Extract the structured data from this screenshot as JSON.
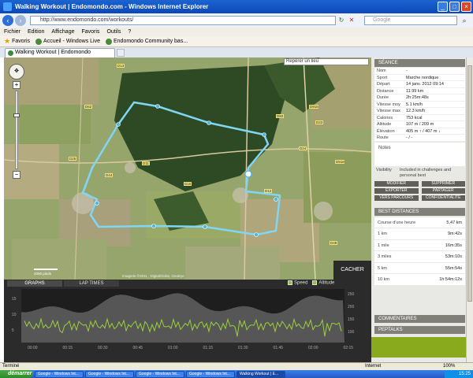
{
  "window": {
    "title": "Walking Workout | Endomondo.com - Windows Internet Explorer"
  },
  "address": {
    "url": "http://www.endomondo.com/workouts/",
    "search_placeholder": "Google"
  },
  "menu": [
    "Fichier",
    "Edition",
    "Affichage",
    "Favoris",
    "Outils",
    "?"
  ],
  "favbar": {
    "favoris": "Favoris",
    "items": [
      "Accueil - Windows Live",
      "Endomondo  Community bas..."
    ]
  },
  "tab": {
    "label": "Walking Workout | Endomondo"
  },
  "map": {
    "search_placeholder": "Repérer un lieu",
    "labels": [
      "D25",
      "D62",
      "D13",
      "D44",
      "D11",
      "D15",
      "D915",
      "D23",
      "D12",
      "D24",
      "D82",
      "D918",
      "D49"
    ],
    "copyright": "Imagerie ©2011 , DigitalGlobe, GeoEye",
    "scale": "2000 pieds"
  },
  "graph": {
    "tabs": [
      "GRAPHS",
      "LAP TIMES"
    ],
    "checks": [
      "Speed",
      "Altitude"
    ],
    "cacher": "CACHER",
    "x_ticks": [
      "00:00",
      "00:15",
      "00:30",
      "00:45",
      "01:00",
      "01:15",
      "01:30",
      "01:45",
      "02:00",
      "02:15"
    ],
    "left_ticks": [
      "15",
      "10",
      "5"
    ],
    "right_ticks": [
      "250",
      "200",
      "150",
      "100"
    ]
  },
  "session": {
    "header": "SÉANCE",
    "rows": [
      {
        "k": "Nom",
        "v": "-"
      },
      {
        "k": "Sport",
        "v": "Marche nordique"
      },
      {
        "k": "Départ",
        "v": "14 janv. 2012 09:14"
      },
      {
        "k": "Distance",
        "v": "11.99 km"
      },
      {
        "k": "Durée",
        "v": "2h:25m:48s"
      },
      {
        "k": "Vitesse moy",
        "v": "5.1 km/h"
      },
      {
        "k": "Vitesse max",
        "v": "12.3 km/h"
      },
      {
        "k": "Calories",
        "v": "753 kcal"
      },
      {
        "k": "Altitude",
        "v": "107 m / 209 m"
      },
      {
        "k": "Élévation",
        "v": "405 m ↑ / 407 m ↓"
      },
      {
        "k": "Route",
        "v": "- / -"
      }
    ],
    "notes_label": "Notes",
    "visibility_label": "Visibility",
    "visibility_value": "Included in challenges and personal best",
    "buttons": [
      "MODIFIER",
      "SUPPRIMER",
      "EXPORTER",
      "PARTAGER",
      "VERS PARCOURS",
      "CONFIDENTIALITÉ"
    ]
  },
  "best": {
    "header": "BEST DISTANCES",
    "rows": [
      {
        "k": "Course d'une heure",
        "v": "5,47 km"
      },
      {
        "k": "1 km",
        "v": "9m:42s"
      },
      {
        "k": "1 mile",
        "v": "16m:35s"
      },
      {
        "k": "3 miles",
        "v": "53m:10s"
      },
      {
        "k": "5 km",
        "v": "55m:54s"
      },
      {
        "k": "10 km",
        "v": "1h:54m:12s"
      }
    ]
  },
  "sections": {
    "comments": "COMMENTAIRES",
    "peptalks": "PEPTALKS"
  },
  "status": {
    "left": "Terminé",
    "zone": "Internet",
    "zoom": "100%"
  },
  "taskbar": {
    "start": "démarrer",
    "tasks": [
      "Google - Windows Int...",
      "Google - Windows Int...",
      "Google - Windows Int...",
      "Google - Windows Int...",
      "Walking Workout | E..."
    ],
    "clock": "15:25"
  }
}
